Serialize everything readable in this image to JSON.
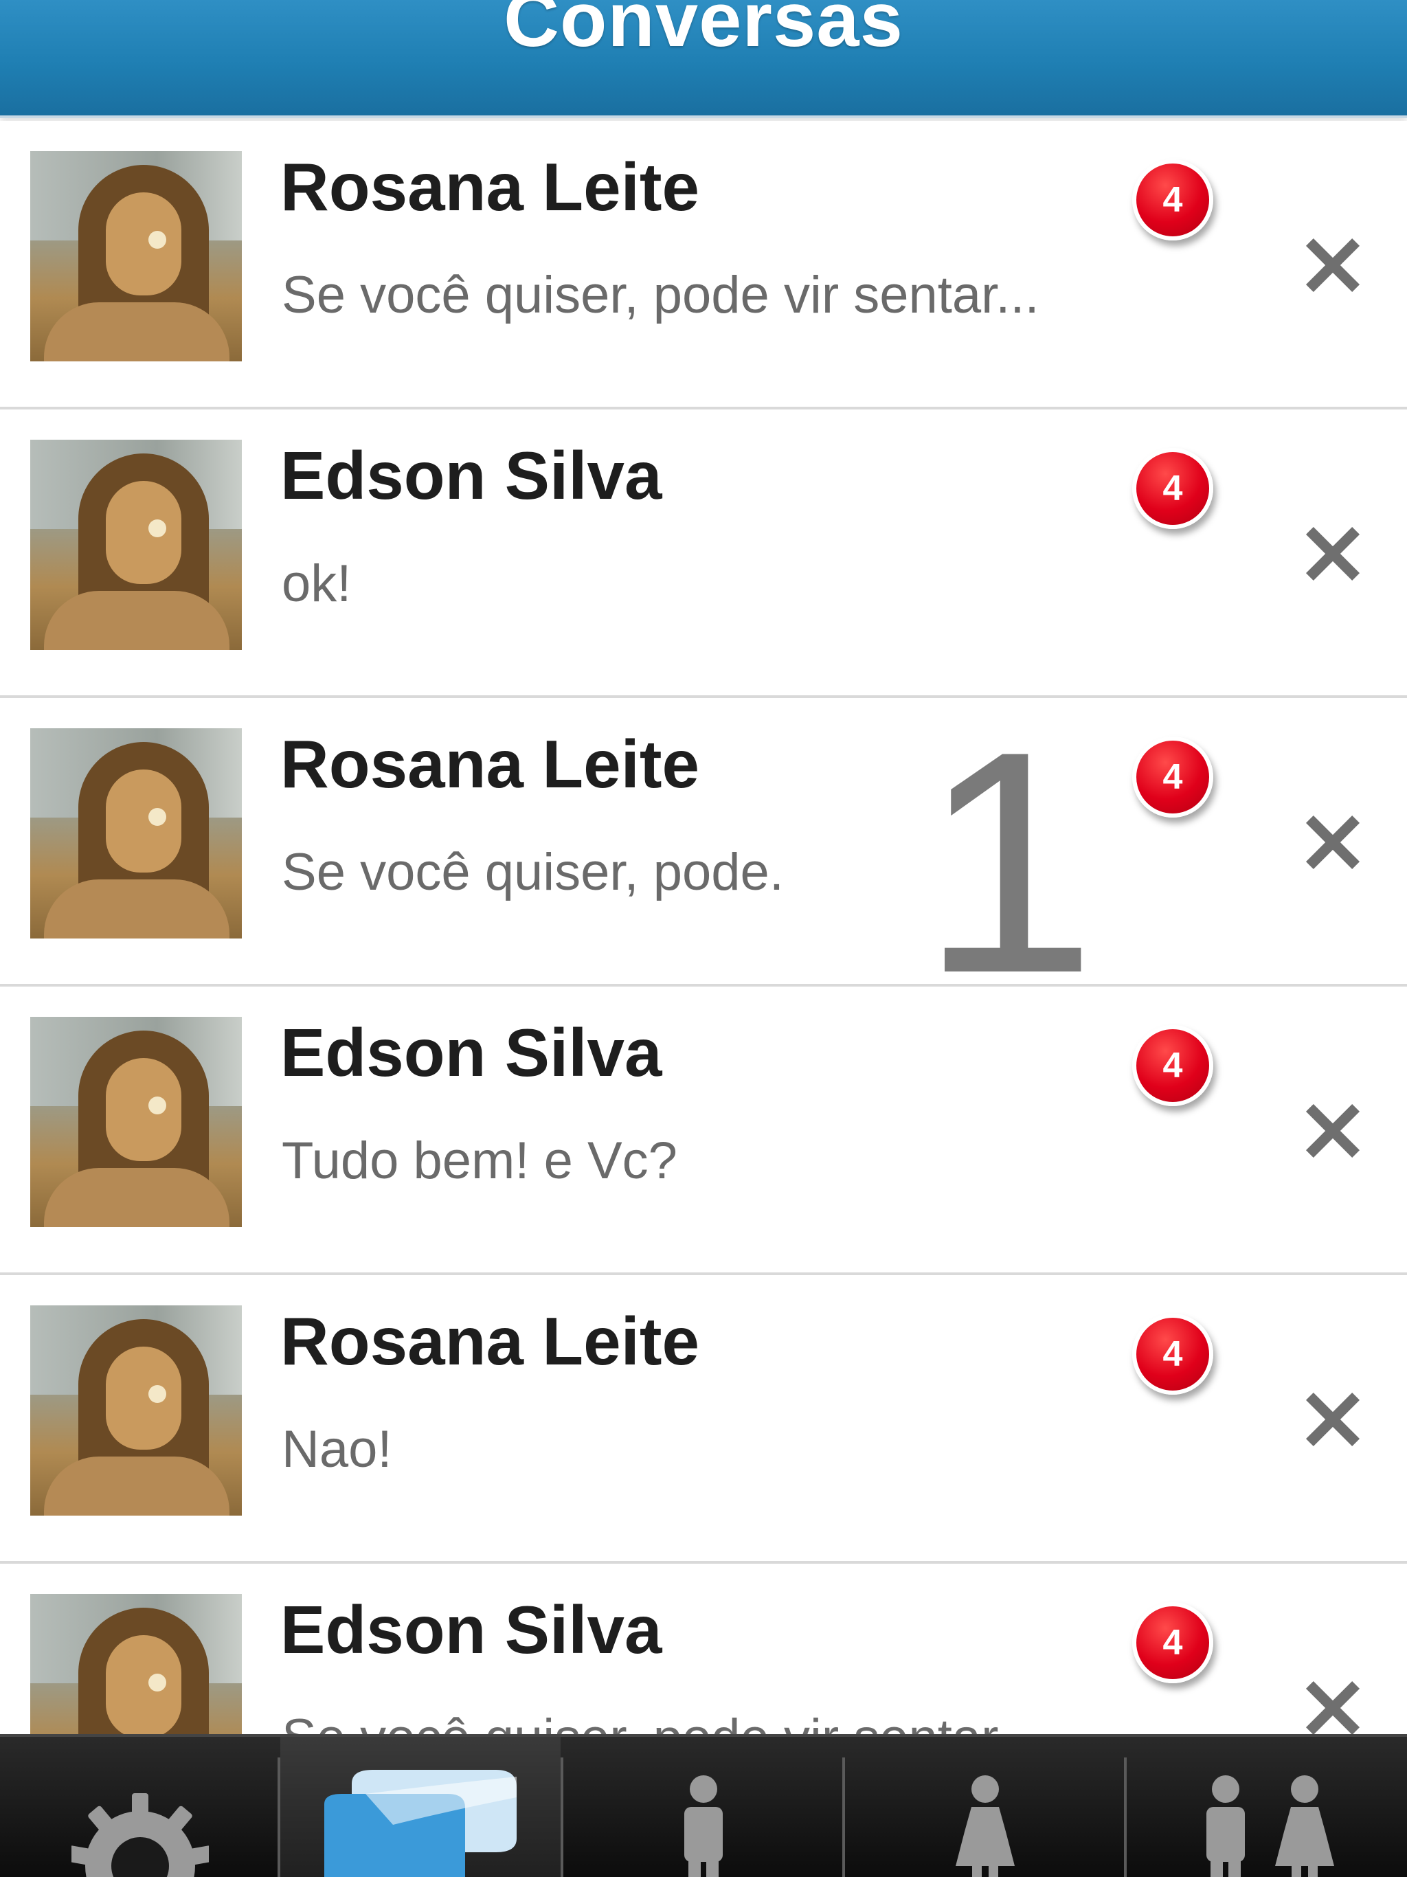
{
  "header": {
    "title": "Conversas"
  },
  "conversations": [
    {
      "name": "Rosana Leite",
      "preview": "Se você quiser, pode vir sentar...",
      "unread": "4"
    },
    {
      "name": "Edson Silva",
      "preview": "ok!",
      "unread": "4"
    },
    {
      "name": "Rosana Leite",
      "preview": "Se você quiser, pode.",
      "unread": "4"
    },
    {
      "name": "Edson Silva",
      "preview": "Tudo bem! e Vc?",
      "unread": "4"
    },
    {
      "name": "Rosana Leite",
      "preview": "Nao!",
      "unread": "4"
    },
    {
      "name": "Edson Silva",
      "preview": "Se você quiser, pode vir sentar...",
      "unread": "4"
    }
  ],
  "overlay": {
    "digit": "1"
  },
  "tabbar": {
    "tabs": [
      {
        "icon": "gear-icon",
        "active": false
      },
      {
        "icon": "chat-bubbles-icon",
        "active": true
      },
      {
        "icon": "male-person-icon",
        "active": false
      },
      {
        "icon": "female-person-icon",
        "active": false
      },
      {
        "icon": "couple-icon",
        "active": false
      }
    ]
  }
}
